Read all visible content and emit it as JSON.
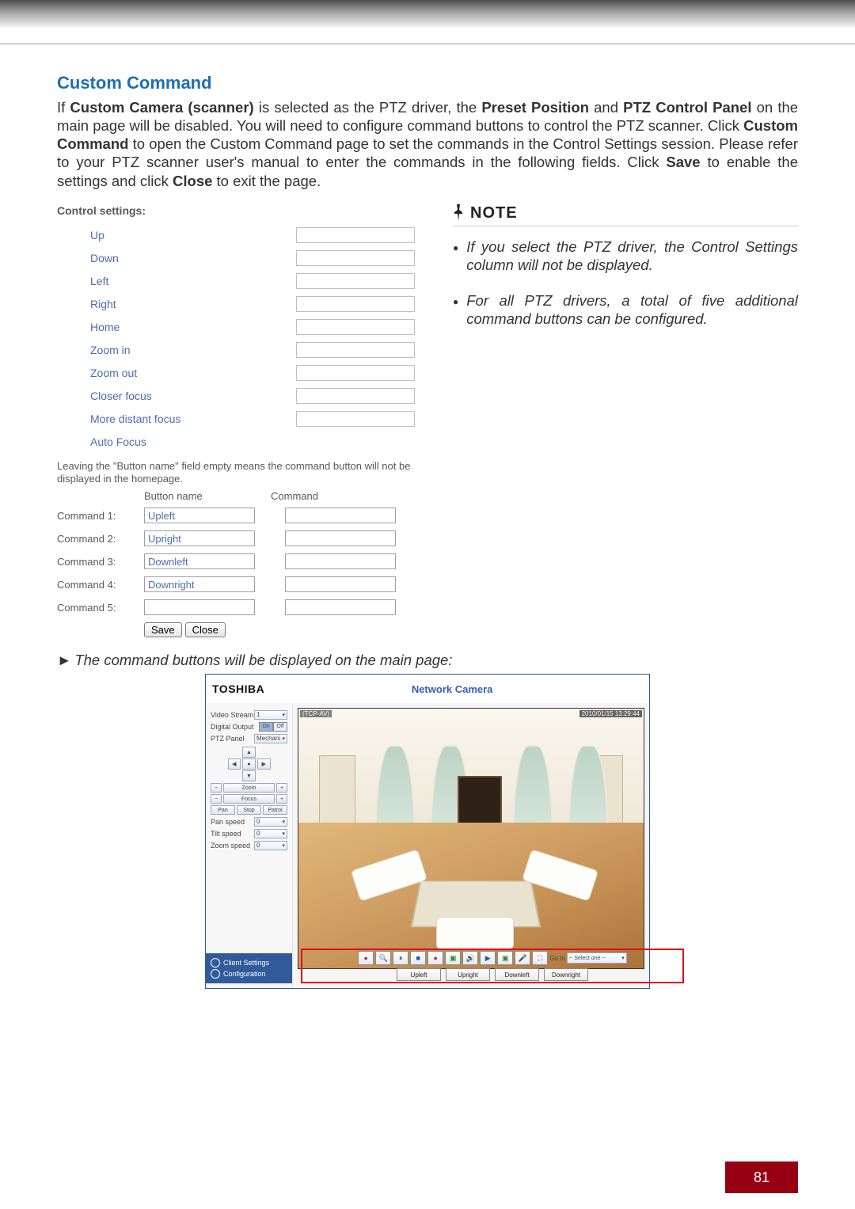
{
  "heading": "Custom Command",
  "paragraph_parts": {
    "p1": "If ",
    "b1": "Custom Camera (scanner)",
    "p2": " is selected as the PTZ driver, the ",
    "b2": "Preset Position",
    "p3": " and ",
    "b3": "PTZ Control Panel",
    "p4": " on the main page will be disabled. You will need to configure command buttons to control the PTZ scanner. Click ",
    "b4": "Custom Command",
    "p5": " to open the Custom Command page to set the commands in the Control Settings session. Please refer to your PTZ scanner user's manual to enter the commands in the following fields. Click ",
    "b5": "Save",
    "p6": " to enable the settings and click ",
    "b6": "Close",
    "p7": " to exit the page."
  },
  "control_settings_label": "Control settings:",
  "control_rows": [
    "Up",
    "Down",
    "Left",
    "Right",
    "Home",
    "Zoom in",
    "Zoom out",
    "Closer focus",
    "More distant focus",
    "Auto Focus"
  ],
  "hint": "Leaving the \"Button name\" field empty means the command button will not be displayed in the homepage.",
  "cmd_headers": {
    "c2": "Button name",
    "c3": "Command"
  },
  "commands": [
    {
      "label": "Command 1:",
      "name": "Upleft",
      "cmd": ""
    },
    {
      "label": "Command 2:",
      "name": "Upright",
      "cmd": ""
    },
    {
      "label": "Command 3:",
      "name": "Downleft",
      "cmd": ""
    },
    {
      "label": "Command 4:",
      "name": "Downright",
      "cmd": ""
    },
    {
      "label": "Command 5:",
      "name": "",
      "cmd": ""
    }
  ],
  "buttons": {
    "save": "Save",
    "close": "Close"
  },
  "note": {
    "title": "NOTE",
    "items": [
      "If you select the PTZ driver, the Control Settings column will not be displayed.",
      "For all PTZ drivers, a total of five additional command buttons can be configured."
    ]
  },
  "arrow_line": "The command buttons will be displayed on the main page:",
  "camera": {
    "logo": "TOSHIBA",
    "title": "Network Camera",
    "side": {
      "video_stream_label": "Video Stream",
      "video_stream_value": "1",
      "digital_output_label": "Digital Output",
      "digital_output_on": "On",
      "digital_output_off": "Off",
      "ptz_panel_label": "PTZ Panel",
      "ptz_panel_value": "Mechani",
      "zoom": "Zoom",
      "focus": "Focus",
      "pan": "Pan",
      "stop": "Stop",
      "patrol": "Patrol",
      "pan_speed": "Pan speed",
      "tilt_speed": "Tilt speed",
      "zoom_speed": "Zoom speed",
      "speed_val": "0",
      "client_settings": "Client Settings",
      "configuration": "Configuration"
    },
    "overlay": {
      "tag": "(TCP-AV)",
      "time": "2010/01/15 13:29:44"
    },
    "goto_label": "Go to",
    "goto_value": "-- Select one --",
    "cmd_buttons": [
      "Upleft",
      "Upright",
      "Downleft",
      "Downright"
    ]
  },
  "page_number": "81"
}
